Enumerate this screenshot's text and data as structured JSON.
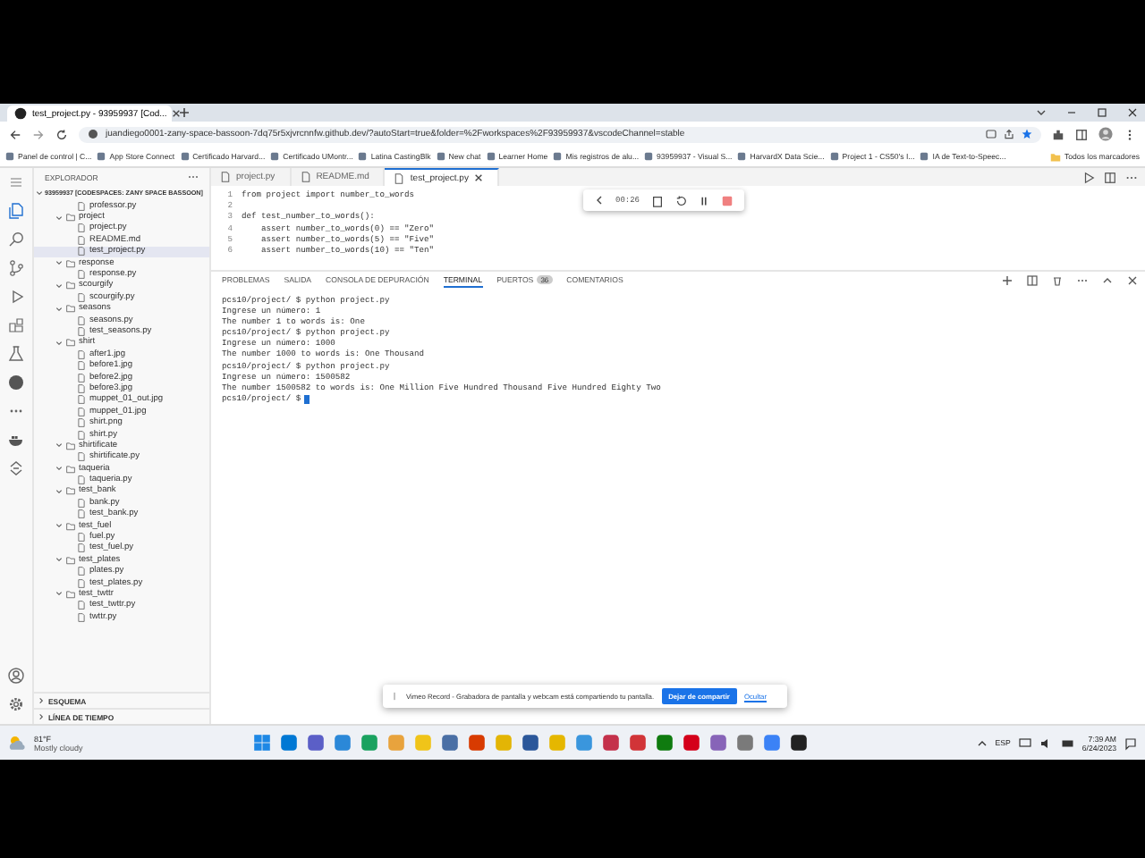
{
  "browser": {
    "tab_title": "test_project.py - 93959937 [Cod...",
    "url": "juandiego0001-zany-space-bassoon-7dq75r5xjvrcnnfw.github.dev/?autoStart=true&folder=%2Fworkspaces%2F93959937&vscodeChannel=stable",
    "bookmarks": [
      "Panel de control | C...",
      "App Store Connect",
      "Certificado Harvard...",
      "Certificado UMontr...",
      "Latina CastingBlk",
      "New chat",
      "Learner Home",
      "Mis registros de alu...",
      "93959937 - Visual S...",
      "HarvardX Data Scie...",
      "Project 1 - CS50's I...",
      "IA de Text-to-Speec..."
    ],
    "all_bookmarks": "Todos los marcadores"
  },
  "explorer": {
    "title": "EXPLORADOR",
    "root": {
      "label": "93959937 [CODESPACES: ZANY SPACE BASSOON]",
      "expanded": true
    },
    "tree": [
      {
        "label": "professor.py",
        "kind": "file",
        "selected": false
      },
      {
        "label": "project",
        "kind": "folder",
        "expanded": true,
        "selected": false,
        "children": [
          {
            "label": "project.py",
            "kind": "file",
            "selected": false
          },
          {
            "label": "README.md",
            "kind": "file",
            "selected": false
          },
          {
            "label": "test_project.py",
            "kind": "file",
            "selected": true
          }
        ]
      },
      {
        "label": "response",
        "kind": "folder",
        "expanded": true,
        "selected": false,
        "children": [
          {
            "label": "response.py",
            "kind": "file",
            "selected": false
          }
        ]
      },
      {
        "label": "scourgify",
        "kind": "folder",
        "expanded": true,
        "selected": false,
        "children": [
          {
            "label": "scourgify.py",
            "kind": "file",
            "selected": false
          }
        ]
      },
      {
        "label": "seasons",
        "kind": "folder",
        "expanded": true,
        "selected": false,
        "children": [
          {
            "label": "seasons.py",
            "kind": "file",
            "selected": false
          },
          {
            "label": "test_seasons.py",
            "kind": "file",
            "selected": false
          }
        ]
      },
      {
        "label": "shirt",
        "kind": "folder",
        "expanded": true,
        "selected": false,
        "children": [
          {
            "label": "after1.jpg",
            "kind": "file",
            "selected": false
          },
          {
            "label": "before1.jpg",
            "kind": "file",
            "selected": false
          },
          {
            "label": "before2.jpg",
            "kind": "file",
            "selected": false
          },
          {
            "label": "before3.jpg",
            "kind": "file",
            "selected": false
          },
          {
            "label": "muppet_01_out.jpg",
            "kind": "file",
            "selected": false
          },
          {
            "label": "muppet_01.jpg",
            "kind": "file",
            "selected": false
          },
          {
            "label": "shirt.png",
            "kind": "file",
            "selected": false
          },
          {
            "label": "shirt.py",
            "kind": "file",
            "selected": false
          }
        ]
      },
      {
        "label": "shirtificate",
        "kind": "folder",
        "expanded": true,
        "selected": false,
        "children": [
          {
            "label": "shirtificate.py",
            "kind": "file",
            "selected": false
          }
        ]
      },
      {
        "label": "taqueria",
        "kind": "folder",
        "expanded": true,
        "selected": false,
        "children": [
          {
            "label": "taqueria.py",
            "kind": "file",
            "selected": false
          }
        ]
      },
      {
        "label": "test_bank",
        "kind": "folder",
        "expanded": true,
        "selected": false,
        "children": [
          {
            "label": "bank.py",
            "kind": "file",
            "selected": false
          },
          {
            "label": "test_bank.py",
            "kind": "file",
            "selected": false
          }
        ]
      },
      {
        "label": "test_fuel",
        "kind": "folder",
        "expanded": true,
        "selected": false,
        "children": [
          {
            "label": "fuel.py",
            "kind": "file",
            "selected": false
          },
          {
            "label": "test_fuel.py",
            "kind": "file",
            "selected": false
          }
        ]
      },
      {
        "label": "test_plates",
        "kind": "folder",
        "expanded": true,
        "selected": false,
        "children": [
          {
            "label": "plates.py",
            "kind": "file",
            "selected": false
          },
          {
            "label": "test_plates.py",
            "kind": "file",
            "selected": false
          }
        ]
      },
      {
        "label": "test_twttr",
        "kind": "folder",
        "expanded": true,
        "selected": false,
        "children": [
          {
            "label": "test_twttr.py",
            "kind": "file",
            "selected": false
          },
          {
            "label": "twttr.py",
            "kind": "file",
            "selected": false
          }
        ]
      }
    ],
    "sections": [
      {
        "label": "ESQUEMA",
        "expanded": false
      },
      {
        "label": "LÍNEA DE TIEMPO",
        "expanded": false
      }
    ]
  },
  "editor": {
    "tabs": [
      {
        "label": "project.py",
        "selected": false
      },
      {
        "label": "README.md",
        "selected": false
      },
      {
        "label": "test_project.py",
        "selected": true
      }
    ],
    "debug_timer": "00:26",
    "lines": [
      {
        "number": "1",
        "code": "from project import number_to_words"
      },
      {
        "number": "2"
      },
      {
        "number": "3",
        "code": "def test_number_to_words():"
      },
      {
        "number": "4",
        "code": "    assert number_to_words(0) == \"Zero\""
      },
      {
        "number": "5",
        "code": "    assert number_to_words(5) == \"Five\""
      },
      {
        "number": "6",
        "code": "    assert number_to_words(10) == \"Ten\""
      }
    ]
  },
  "panel": {
    "tabs": [
      {
        "label": "PROBLEMAS",
        "selected": false
      },
      {
        "label": "SALIDA",
        "selected": false
      },
      {
        "label": "CONSOLA DE DEPURACIÓN",
        "selected": false
      },
      {
        "label": "TERMINAL",
        "selected": true
      },
      {
        "label": "PUERTOS",
        "selected": false,
        "badge": "36"
      },
      {
        "label": "COMENTARIOS",
        "selected": false
      }
    ],
    "terminal_lines": [
      "pcs10/project/ $ python project.py",
      "Ingrese un número: 1",
      "The number 1 to words is: One",
      "pcs10/project/ $ python project.py",
      "Ingrese un número: 1000",
      "The number 1000 to words is: One Thousand",
      "pcs10/project/ $ python project.py",
      "Ingrese un número: 1500582",
      "The number 1500582 to words is: One Million Five Hundred Thousand Five Hundred Eighty Two"
    ],
    "prompt": "pcs10/project/ $"
  },
  "notification": {
    "message": "Vimeo Record - Grabadora de pantalla y webcam está compartiendo tu pantalla.",
    "button": "Dejar de compartir",
    "link": "Ocultar"
  },
  "taskbar": {
    "temperature": "81°F",
    "condition": "Mostly cloudy",
    "language": "ESP",
    "time": "7:39 AM",
    "date": "6/24/2023"
  }
}
